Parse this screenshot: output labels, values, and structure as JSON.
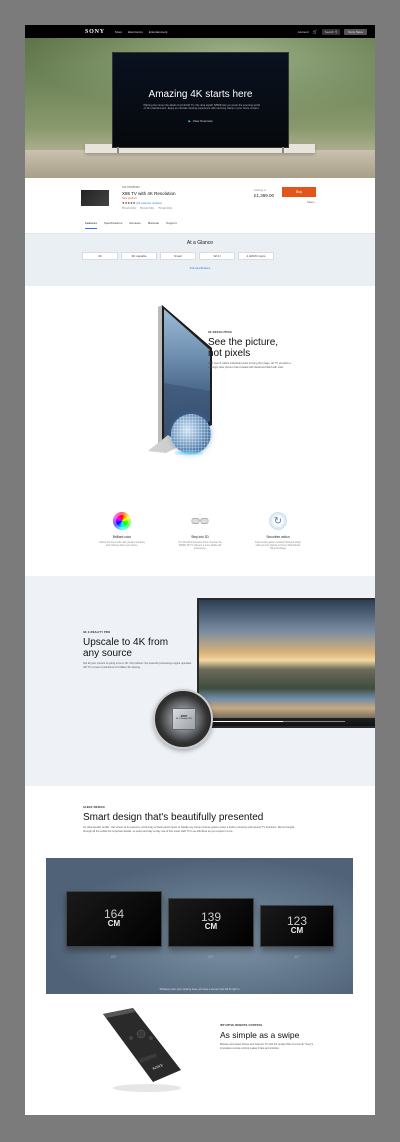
{
  "nav": {
    "logo": "SONY",
    "links": [
      "Store",
      "Electronics",
      "Entertainment"
    ],
    "account": "Account",
    "search": "Search",
    "store_button": "Sony Store"
  },
  "hero": {
    "title": "Amazing 4K starts here",
    "description": "Offering four times the detail of a Full HD TV, this ultra stylish X850D lets you enter the stunning world of 4K entertainment. Enjoy an ultimate viewing experience with stunning clarity in your home content.",
    "video_link": "View Overview"
  },
  "product": {
    "model": "KD-55X850D",
    "name": "X85 TV with 4K Resolution",
    "new_tag": "New product",
    "stars": "★★★★★",
    "reviews": "(25 customer reviews)",
    "sizes": [
      "55 inch (KD-)",
      "65 inch (KD-)",
      "75 inch (KD-)"
    ],
    "price_label": "Starting at",
    "price": "£1,399.00",
    "buy_label": "Buy",
    "share_label": "Share",
    "tabs": [
      "Features",
      "Specifications",
      "Reviews",
      "Manuals",
      "Support"
    ]
  },
  "glance": {
    "title": "At a Glance",
    "chips": [
      "4K",
      "3D capable",
      "Smart",
      "Wi-Fi",
      "4 HDMI inputs"
    ],
    "link": "Full specifications"
  },
  "resolution": {
    "eyebrow": "4K RESOLUTION",
    "title_line1": "See the picture,",
    "title_line2": "not pixels",
    "body": "With over 8 million individual pixels forming the image, 4K TV provides a strikingly clear picture that's loaded with detail and filled with color."
  },
  "features": [
    {
      "title": "Brilliant color",
      "desc": "Colors are true-to-life with greater accuracy and richness than ever before."
    },
    {
      "title": "Step into 3D",
      "desc": "For 3D with immersive home cinema, the X850D 3D TV delivers a more lifelike 3D experience."
    },
    {
      "title": "Smoother action",
      "desc": "Fast-moving action remains fluid and sharp with less blur thanks to Sony's MotionFlow XR technology."
    }
  ],
  "upscale": {
    "eyebrow": "4K X-REALITY PRO",
    "title_line1": "Upscale to 4K from",
    "title_line2": "any source",
    "body": "Not all your content is going to be in 4K. No problem: the powerful processing engine upscales HD TV or lower resolutions for brilliant 4K viewing.",
    "chip_brand": "SONY",
    "chip_label": "4K X-Reality PRO"
  },
  "sleek": {
    "eyebrow": "SLEEK DESIGN",
    "title": "Smart design that's beautifully presented",
    "body": "An ultra-slender profile - flat screen at its essence. A full array of back panel inputs to handle any home cinema system (even a built-in camera) and internet TV functions. We've thought through all the subtle but important details, so setup and day-to-day use of this smart LED TV is as effortless as you expect it to be.",
    "sizes": [
      {
        "num": "164",
        "unit": "CM",
        "inch": "65\""
      },
      {
        "num": "139",
        "unit": "CM",
        "inch": "55\""
      },
      {
        "num": "123",
        "unit": "CM",
        "inch": "49\""
      }
    ],
    "caption": "Whatever size your viewing area, we have a screen that will fit right in"
  },
  "remote": {
    "eyebrow": "INTUITIVE REMOTE CONTROL",
    "title": "As simple as a swipe",
    "body": "Browse and select shows and Internet TV with the simple flick of a thumb. Sony's innovative remote control makes it fast and intuitive.",
    "remote_brand": "SONY"
  },
  "colors": {
    "accent": "#e2541a",
    "link": "#2a7be4",
    "background": "#7b7b7b",
    "glance_bg": "#eaeff4"
  }
}
